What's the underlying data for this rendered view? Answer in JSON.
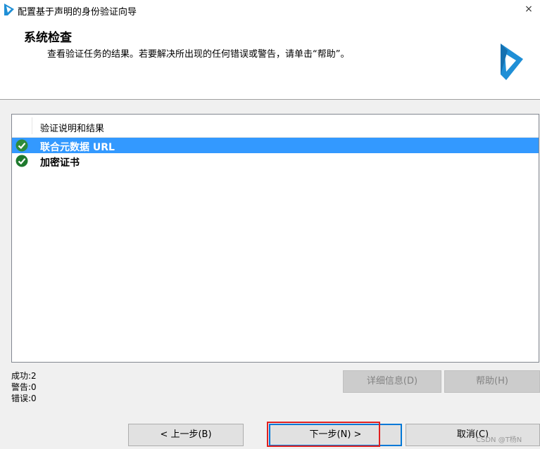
{
  "window": {
    "title": "配置基于声明的身份验证向导",
    "close_label": "×"
  },
  "header": {
    "title": "系统检查",
    "subtitle": "查看验证任务的结果。若要解决所出现的任何错误或警告，请单击“帮助”。"
  },
  "list": {
    "column_header": "验证说明和结果",
    "items": [
      {
        "label": "联合元数据 URL",
        "status": "success",
        "selected": true
      },
      {
        "label": "加密证书",
        "status": "success",
        "selected": false
      }
    ]
  },
  "stats": {
    "success": "成功:2",
    "warning": "警告:0",
    "error": "错误:0"
  },
  "buttons": {
    "details": "详细信息(D)",
    "help": "帮助(H)",
    "back": "< 上一步(B)",
    "next": "下一步(N) >",
    "cancel": "取消(C)"
  },
  "watermark": "CSDN @T杨N",
  "colors": {
    "selection": "#3399ff",
    "success_icon": "#2e8b3a",
    "highlight_outline": "#e02020",
    "logo": "#1f8fd6"
  }
}
